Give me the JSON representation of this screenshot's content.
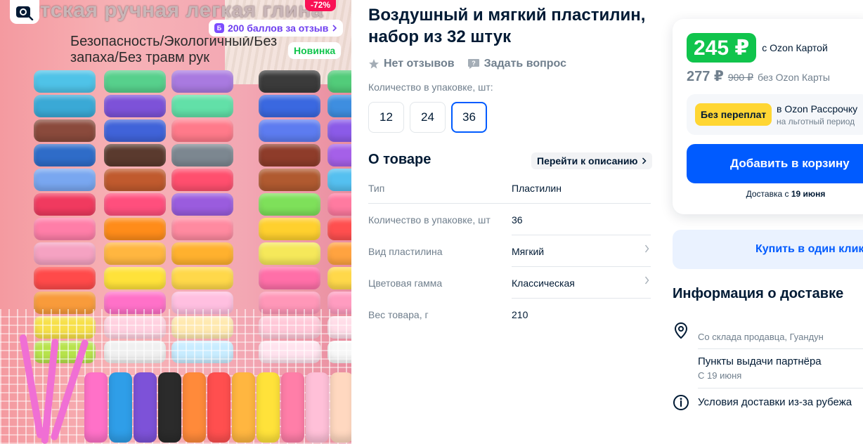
{
  "gallery": {
    "headline": "етская ручная легкая глина",
    "subtext_line1": "Безопасность/Экологичный/Без",
    "subtext_line2": "запаха/Без травм рук",
    "discount": "-72%",
    "points_badge": "200 баллов за отзыв",
    "new_badge": "Новинка",
    "search_icon": "camera-search-icon"
  },
  "product": {
    "title": "Воздушный и мягкий пластилин, набор из 32 штук",
    "reviews": "Нет отзывов",
    "ask_question": "Задать вопрос",
    "qty_label": "Количество в упаковке, шт:",
    "qty_options": [
      "12",
      "24",
      "36"
    ],
    "qty_selected": "36"
  },
  "about": {
    "title": "О товаре",
    "goto_description": "Перейти к описанию",
    "specs": [
      {
        "key": "Тип",
        "value": "Пластилин"
      },
      {
        "key": "Количество в упаковке, шт",
        "value": "36"
      },
      {
        "key": "Вид пластилина",
        "value": "Мягкий"
      },
      {
        "key": "Цветовая гамма",
        "value": "Классическая"
      },
      {
        "key": "Вес товара, г",
        "value": "210"
      }
    ]
  },
  "price": {
    "card_price": "245 ₽",
    "card_caption": "с Ozon Картой",
    "regular_price": "277 ₽",
    "old_price": "900 ₽",
    "regular_caption": "без Ozon Карты",
    "installment_badge": "Без переплат",
    "installment_title": "в Ozon Рассрочку",
    "installment_sub": "на льготный период",
    "add_to_cart": "Добавить в корзину",
    "delivery_prefix": "Доставка с",
    "delivery_date": "19 июня",
    "buy_one_click": "Купить в один клик"
  },
  "delivery": {
    "title": "Информация о доставке",
    "warehouse": "Со склада продавца, Гуандун",
    "pickup_title": "Пункты выдачи партнёра",
    "pickup_date": "С 19 июня",
    "conditions": "Условия доставки из-за рубежа"
  },
  "colors": {
    "accent": "#005bff",
    "green": "#10c44c",
    "yellow": "#ffd633",
    "pink": "#f91155",
    "text": "#001a34",
    "muted": "#707f8d"
  }
}
